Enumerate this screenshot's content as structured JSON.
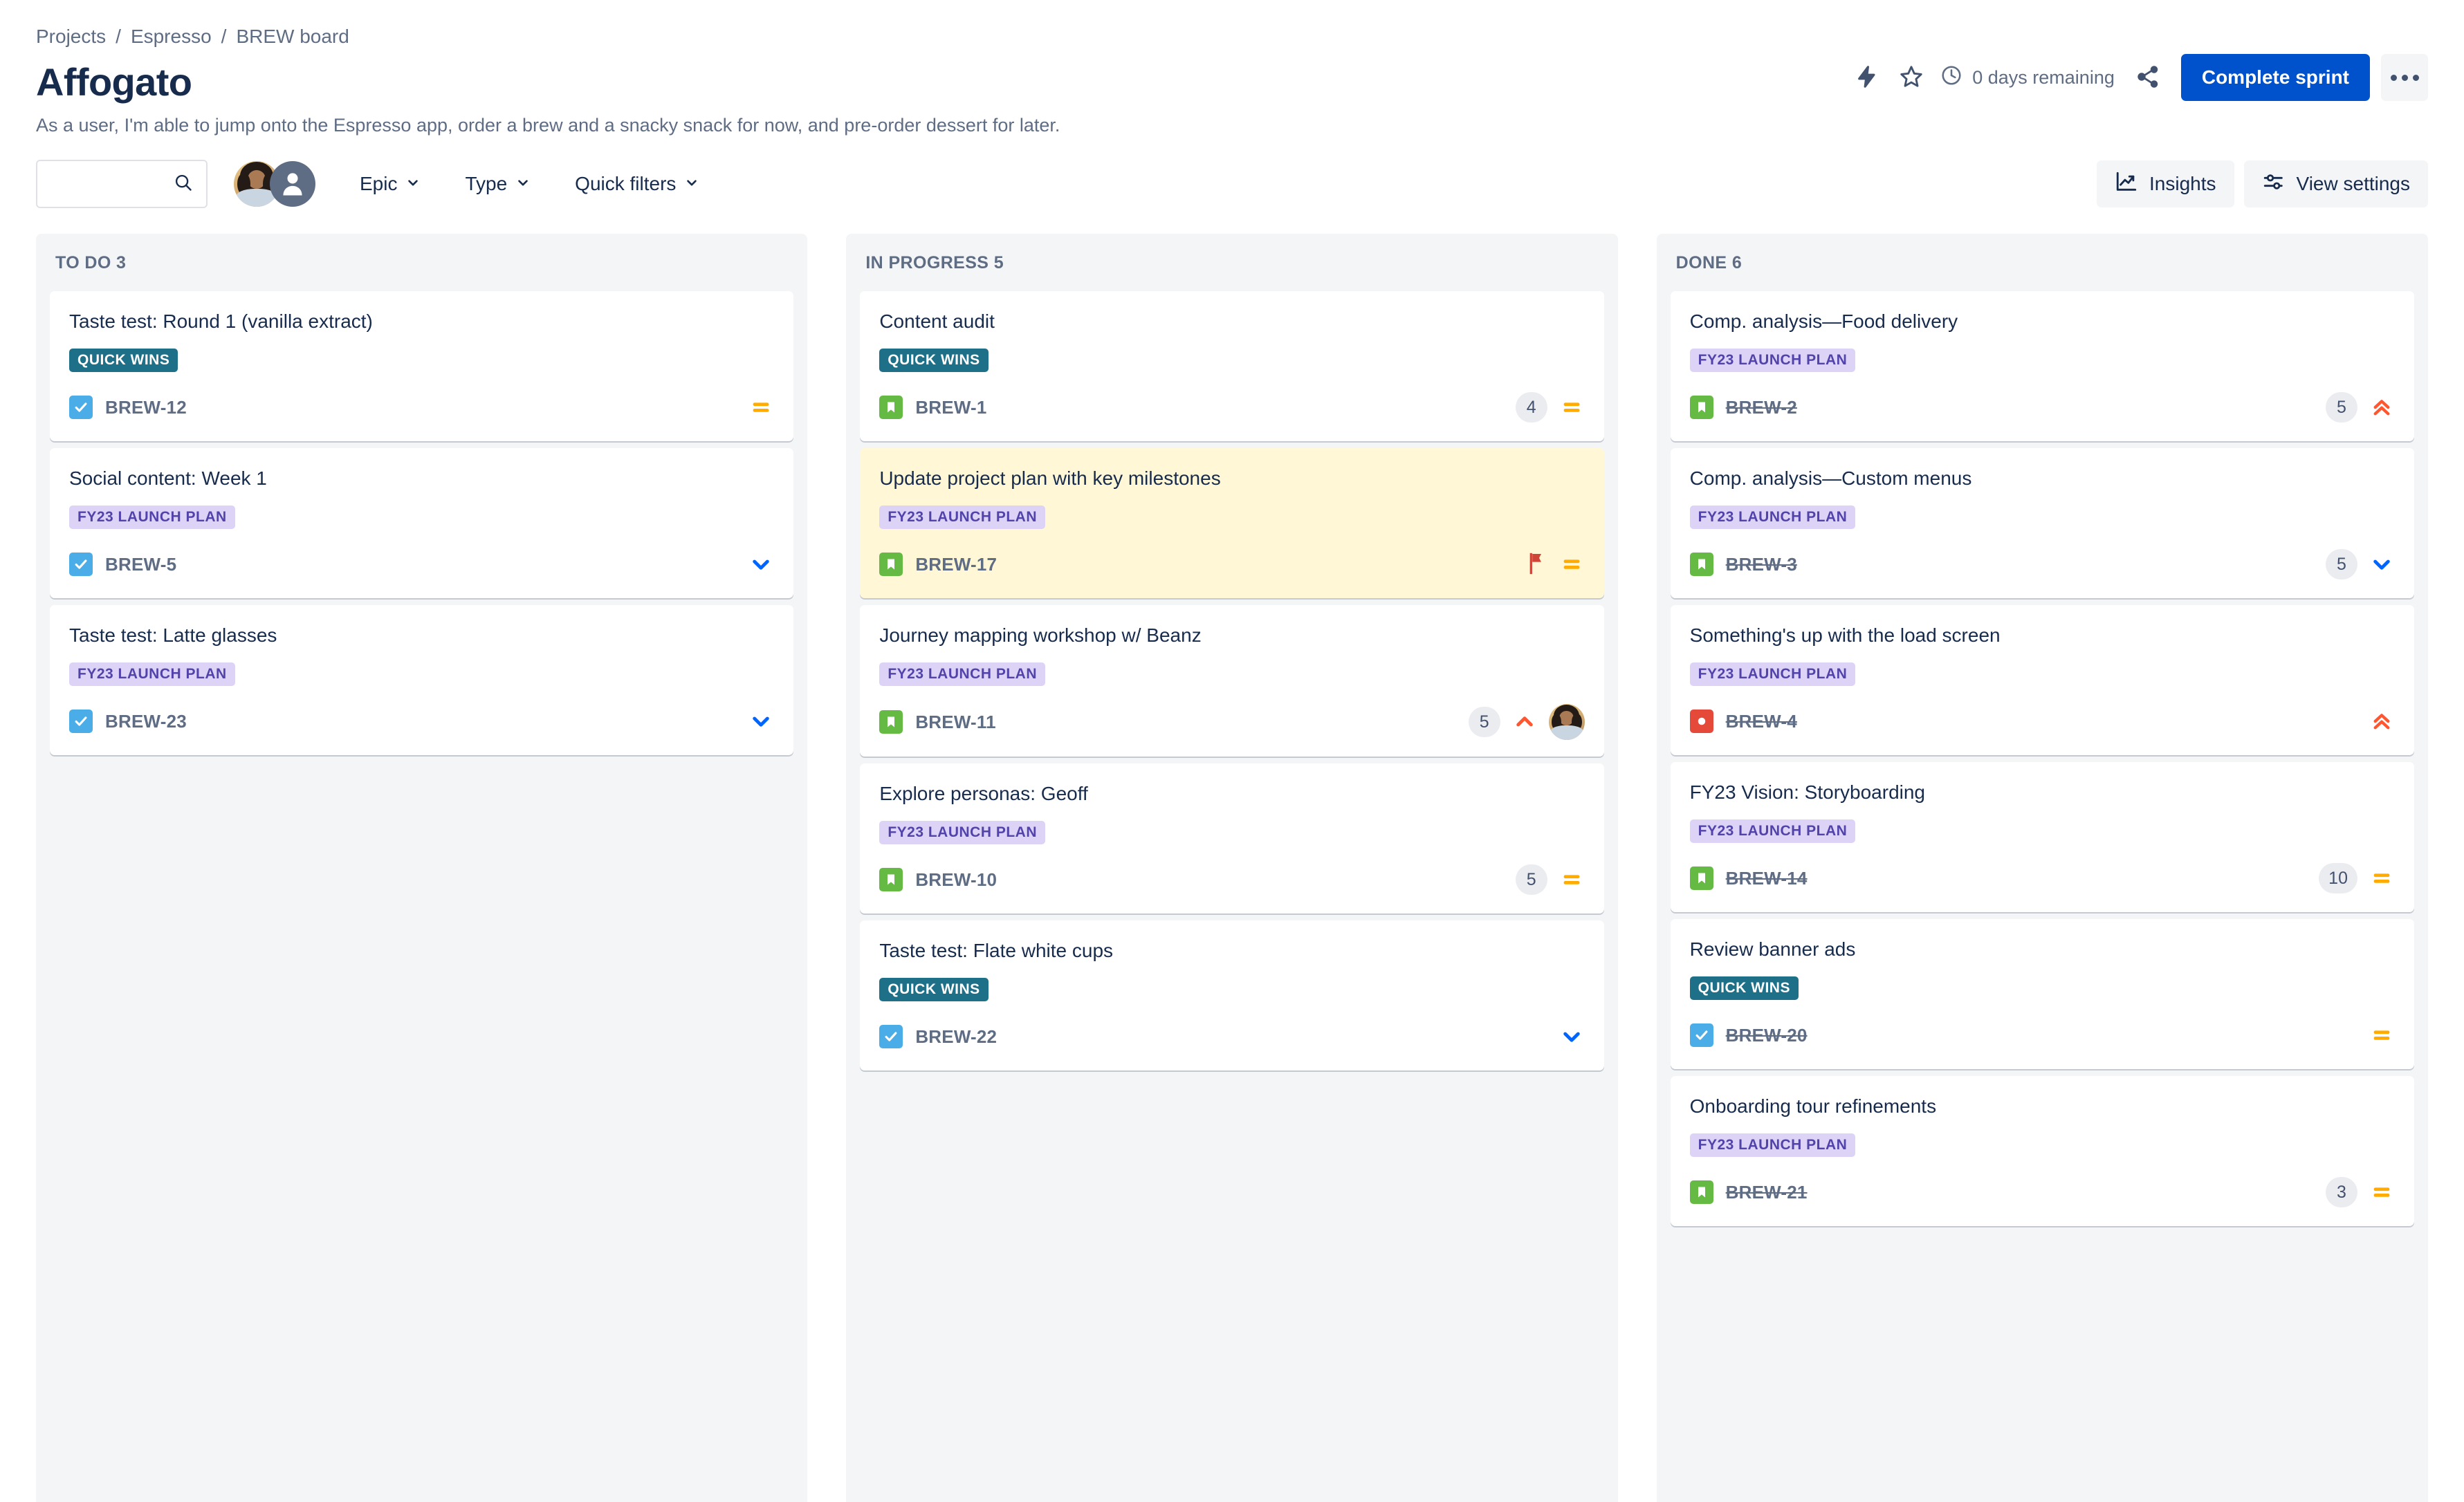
{
  "breadcrumb": {
    "items": [
      "Projects",
      "Espresso",
      "BREW board"
    ],
    "separator": "/"
  },
  "header": {
    "title": "Affogato",
    "subtitle": "As a user, I'm able to jump onto the Espresso app, order a brew and a snacky snack for now, and pre-order dessert for later.",
    "days_remaining": "0 days remaining",
    "complete_sprint_label": "Complete sprint",
    "icons": {
      "lightning": "lightning-icon",
      "star": "star-icon",
      "clock": "clock-icon",
      "share": "share-icon",
      "more": "more-options-icon"
    }
  },
  "toolbar": {
    "search_placeholder": "",
    "search_value": "",
    "filters": [
      {
        "label": "Epic"
      },
      {
        "label": "Type"
      },
      {
        "label": "Quick filters"
      }
    ],
    "insights_label": "Insights",
    "view_settings_label": "View settings",
    "avatars": [
      {
        "name": "avatar-user-photo",
        "type": "photo"
      },
      {
        "name": "avatar-user-default",
        "type": "default"
      }
    ]
  },
  "colors": {
    "primary_button": "#0052cc",
    "column_bg": "#f4f5f7",
    "epic_quick_wins": "#1d7088",
    "epic_fy23": "#dcd3f7",
    "epic_fy23_text": "#5243aa",
    "type_task": "#4bade8",
    "type_story": "#65ba43",
    "type_bug": "#e5493a",
    "priority_medium": "#ffab00",
    "priority_high": "#ff5630",
    "priority_low": "#0065ff",
    "flagged_card": "#fff7d6",
    "flag_red": "#d04437"
  },
  "board": {
    "columns": [
      {
        "id": "todo",
        "name": "TO DO",
        "count": "3",
        "header": "TO DO 3",
        "cards": [
          {
            "title": "Taste test: Round 1 (vanilla extract)",
            "epic": "QUICK WINS",
            "epic_style": "quickwins",
            "key": "BREW-12",
            "type": "task",
            "done": false,
            "points": "",
            "priority": "medium",
            "flagged": false,
            "assignee": false
          },
          {
            "title": "Social content: Week 1",
            "epic": "FY23 LAUNCH PLAN",
            "epic_style": "fy23",
            "key": "BREW-5",
            "type": "task",
            "done": false,
            "points": "",
            "priority": "low",
            "flagged": false,
            "assignee": false
          },
          {
            "title": "Taste test: Latte glasses",
            "epic": "FY23 LAUNCH PLAN",
            "epic_style": "fy23",
            "key": "BREW-23",
            "type": "task",
            "done": false,
            "points": "",
            "priority": "low",
            "flagged": false,
            "assignee": false
          }
        ]
      },
      {
        "id": "inprogress",
        "name": "IN PROGRESS",
        "count": "5",
        "header": "IN PROGRESS 5",
        "cards": [
          {
            "title": "Content audit",
            "epic": "QUICK WINS",
            "epic_style": "quickwins",
            "key": "BREW-1",
            "type": "story",
            "done": false,
            "points": "4",
            "priority": "medium",
            "flagged": false,
            "assignee": false
          },
          {
            "title": "Update project plan with key milestones",
            "epic": "FY23 LAUNCH PLAN",
            "epic_style": "fy23",
            "key": "BREW-17",
            "type": "story",
            "done": false,
            "points": "",
            "priority": "medium",
            "flagged": true,
            "assignee": false
          },
          {
            "title": "Journey mapping workshop w/ Beanz",
            "epic": "FY23 LAUNCH PLAN",
            "epic_style": "fy23",
            "key": "BREW-11",
            "type": "story",
            "done": false,
            "points": "5",
            "priority": "high",
            "flagged": false,
            "assignee": true
          },
          {
            "title": "Explore personas: Geoff",
            "epic": "FY23 LAUNCH PLAN",
            "epic_style": "fy23",
            "key": "BREW-10",
            "type": "story",
            "done": false,
            "points": "5",
            "priority": "medium",
            "flagged": false,
            "assignee": false
          },
          {
            "title": "Taste test: Flate white cups",
            "epic": "QUICK WINS",
            "epic_style": "quickwins",
            "key": "BREW-22",
            "type": "task",
            "done": false,
            "points": "",
            "priority": "low",
            "flagged": false,
            "assignee": false
          }
        ]
      },
      {
        "id": "done",
        "name": "DONE",
        "count": "6",
        "header": "DONE 6",
        "cards": [
          {
            "title": "Comp. analysis—Food delivery",
            "epic": "FY23 LAUNCH PLAN",
            "epic_style": "fy23",
            "key": "BREW-2",
            "type": "story",
            "done": true,
            "points": "5",
            "priority": "highest",
            "flagged": false,
            "assignee": false
          },
          {
            "title": "Comp. analysis—Custom menus",
            "epic": "FY23 LAUNCH PLAN",
            "epic_style": "fy23",
            "key": "BREW-3",
            "type": "story",
            "done": true,
            "points": "5",
            "priority": "low",
            "flagged": false,
            "assignee": false
          },
          {
            "title": "Something's up with the load screen",
            "epic": "FY23 LAUNCH PLAN",
            "epic_style": "fy23",
            "key": "BREW-4",
            "type": "bug",
            "done": true,
            "points": "",
            "priority": "highest",
            "flagged": false,
            "assignee": false
          },
          {
            "title": "FY23 Vision: Storyboarding",
            "epic": "FY23 LAUNCH PLAN",
            "epic_style": "fy23",
            "key": "BREW-14",
            "type": "story",
            "done": true,
            "points": "10",
            "priority": "medium",
            "flagged": false,
            "assignee": false
          },
          {
            "title": "Review banner ads",
            "epic": "QUICK WINS",
            "epic_style": "quickwins",
            "key": "BREW-20",
            "type": "task",
            "done": true,
            "points": "",
            "priority": "medium",
            "flagged": false,
            "assignee": false
          },
          {
            "title": "Onboarding tour refinements",
            "epic": "FY23 LAUNCH PLAN",
            "epic_style": "fy23",
            "key": "BREW-21",
            "type": "story",
            "done": true,
            "points": "3",
            "priority": "medium",
            "flagged": false,
            "assignee": false
          }
        ]
      }
    ]
  }
}
